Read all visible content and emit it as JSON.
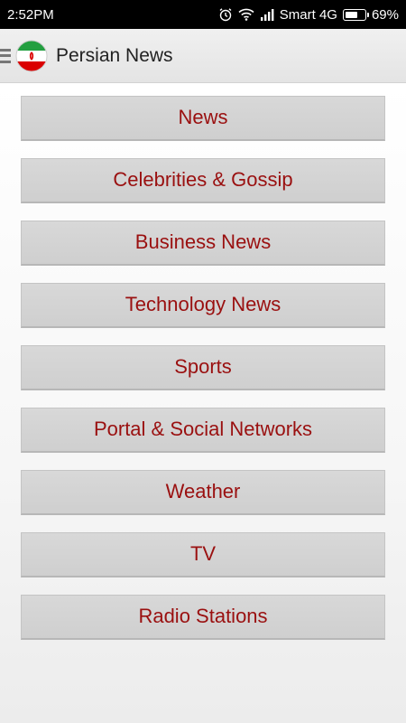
{
  "status_bar": {
    "time": "2:52PM",
    "carrier": "Smart 4G",
    "battery_percent": "69%",
    "battery_level": 0.69,
    "icons": [
      "alarm-icon",
      "wifi-icon",
      "signal-icon",
      "battery-icon"
    ]
  },
  "action_bar": {
    "title": "Persian News",
    "logo_icon": "iran-flag-icon",
    "menu_icon": "hamburger-menu-icon"
  },
  "menu": {
    "items": [
      {
        "label": "News"
      },
      {
        "label": "Celebrities & Gossip"
      },
      {
        "label": "Business News"
      },
      {
        "label": "Technology News"
      },
      {
        "label": "Sports"
      },
      {
        "label": "Portal & Social Networks"
      },
      {
        "label": "Weather"
      },
      {
        "label": "TV"
      },
      {
        "label": "Radio Stations"
      }
    ]
  },
  "colors": {
    "button_text": "#9a1010",
    "flag_green": "#239f40",
    "flag_red": "#da0000"
  }
}
